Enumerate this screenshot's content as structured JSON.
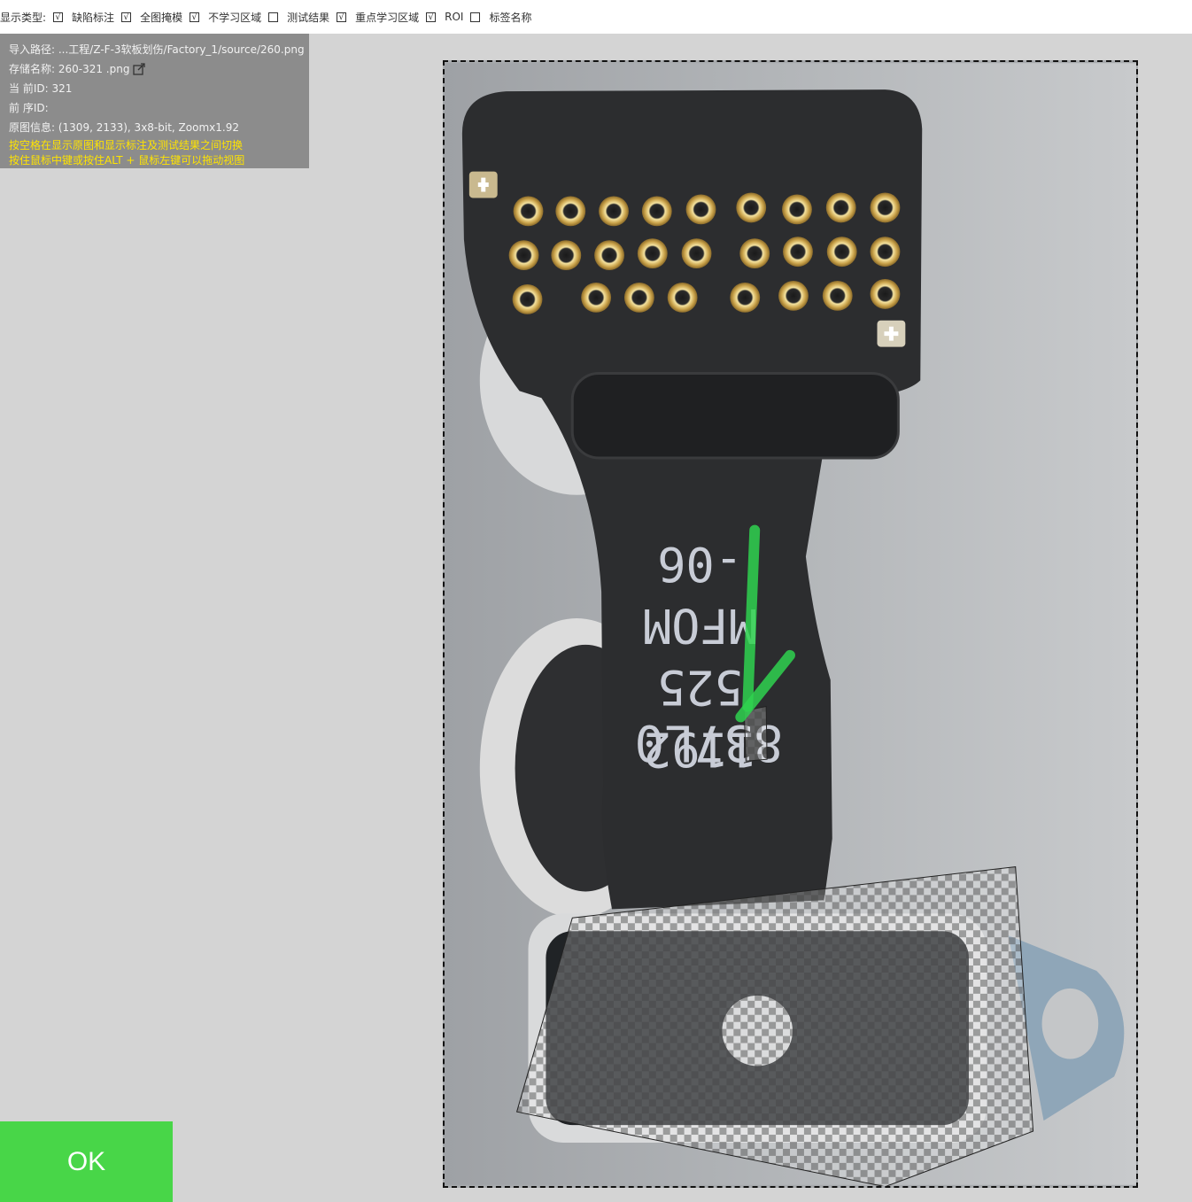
{
  "toolbar": {
    "label": "显示类型:",
    "items": [
      {
        "label": "缺陷标注",
        "checked": true
      },
      {
        "label": "全图掩模",
        "checked": true
      },
      {
        "label": "不学习区域",
        "checked": true
      },
      {
        "label": "测试结果",
        "checked": false
      },
      {
        "label": "重点学习区域",
        "checked": true
      },
      {
        "label": "ROI",
        "checked": true
      },
      {
        "label": "标签名称",
        "checked": false
      }
    ],
    "check_mark": "√"
  },
  "info": {
    "import_path": "导入路径: ...工程/Z-F-3软板划伤/Factory_1/source/260.png",
    "save_name": "存储名称: 260-321  .png",
    "current_id": "当 前ID: 321",
    "prev_id": "前 序ID:",
    "image_info": "原图信息: (1309, 2133), 3x8-bit, Zoomx1.92",
    "hint1": "按空格在显示原图和显示标注及测试结果之间切换",
    "hint2": "按住鼠标中键或按住ALT + 鼠标左键可以拖动视图"
  },
  "image_text": {
    "line1": "1192",
    "line2": "525",
    "line3": "MFOM",
    "line4": "-06",
    "line5": "837L0"
  },
  "ok_button": {
    "label": "OK"
  },
  "colors": {
    "ok_green": "#48d648",
    "hint_yellow": "#ffe400",
    "defect_green": "#2fd24f"
  }
}
